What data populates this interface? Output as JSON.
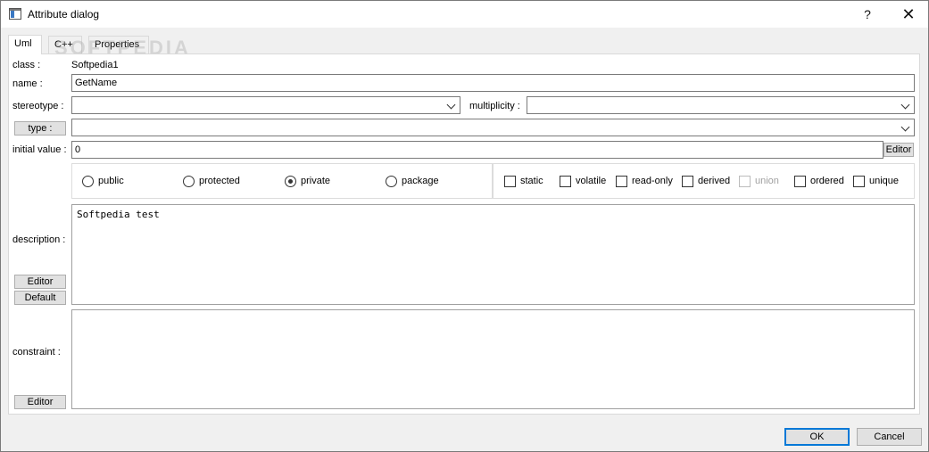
{
  "window": {
    "title": "Attribute dialog",
    "help_glyph": "?",
    "close_glyph": "✕"
  },
  "tabs": [
    {
      "label": "Uml",
      "active": true
    },
    {
      "label": "C++",
      "active": false
    },
    {
      "label": "Properties",
      "active": false
    }
  ],
  "watermark": "SOFTPEDIA",
  "form": {
    "class_label": "class :",
    "class_value": "Softpedia1",
    "name_label": "name :",
    "name_value": "GetName",
    "stereotype_label": "stereotype :",
    "stereotype_value": "",
    "multiplicity_label": "multiplicity :",
    "multiplicity_value": "",
    "type_button": "type :",
    "type_value": "",
    "initial_value_label": "initial value :",
    "initial_value": "0",
    "initial_editor_button": "Editor"
  },
  "visibility": {
    "options": [
      "public",
      "protected",
      "private",
      "package"
    ],
    "selected": "private"
  },
  "flags": [
    {
      "label": "static",
      "checked": false,
      "enabled": true
    },
    {
      "label": "volatile",
      "checked": false,
      "enabled": true
    },
    {
      "label": "read-only",
      "checked": false,
      "enabled": true
    },
    {
      "label": "derived",
      "checked": false,
      "enabled": true
    },
    {
      "label": "union",
      "checked": false,
      "enabled": false
    },
    {
      "label": "ordered",
      "checked": false,
      "enabled": true
    },
    {
      "label": "unique",
      "checked": false,
      "enabled": true
    }
  ],
  "description": {
    "label": "description :",
    "text": "Softpedia test",
    "editor_button": "Editor",
    "default_button": "Default"
  },
  "constraint": {
    "label": "constraint :",
    "text": "",
    "editor_button": "Editor"
  },
  "footer": {
    "ok_button": "OK",
    "cancel_button": "Cancel"
  },
  "colors": {
    "accent": "#0078d7",
    "window_bg": "#f0f0f0"
  }
}
